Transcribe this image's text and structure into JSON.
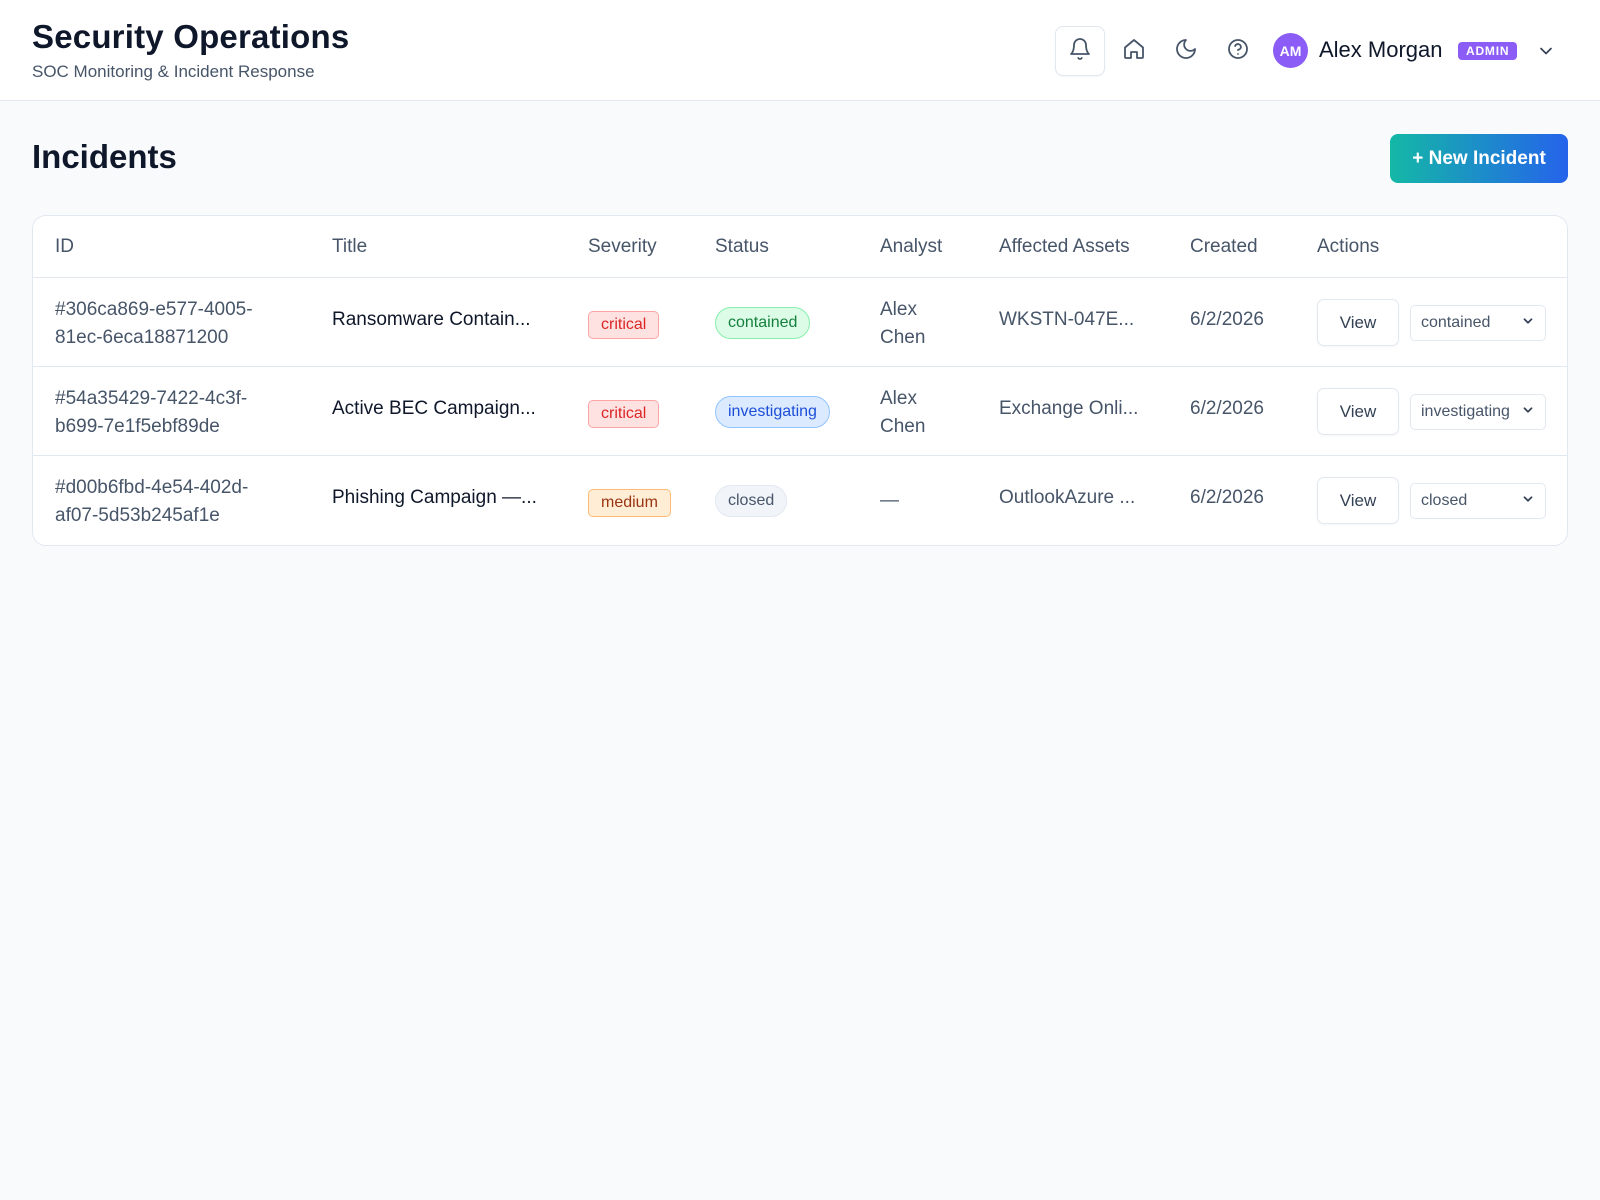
{
  "header": {
    "title": "Security Operations",
    "subtitle": "SOC Monitoring & Incident Response",
    "user": {
      "initials": "AM",
      "name": "Alex Morgan",
      "role": "ADMIN"
    },
    "icons": [
      "bell-icon",
      "home-icon",
      "moon-icon",
      "help-icon",
      "chevron-down-icon"
    ]
  },
  "page": {
    "title": "Incidents",
    "new_button_label": "+ New Incident"
  },
  "table": {
    "columns": [
      "ID",
      "Title",
      "Severity",
      "Status",
      "Analyst",
      "Affected Assets",
      "Created",
      "Actions"
    ],
    "rows": [
      {
        "id_line1": "#306ca869-e577-4005-",
        "id_line2": "81ec-6eca18871200",
        "title": "Ransomware Contain...",
        "severity": "critical",
        "status": "contained",
        "analyst_line1": "Alex",
        "analyst_line2": "Chen",
        "assets": "WKSTN-047E...",
        "created": "6/2/2026",
        "view_label": "View",
        "select_value": "contained"
      },
      {
        "id_line1": "#54a35429-7422-4c3f-",
        "id_line2": "b699-7e1f5ebf89de",
        "title": "Active BEC Campaign...",
        "severity": "critical",
        "status": "investigating",
        "analyst_line1": "Alex",
        "analyst_line2": "Chen",
        "assets": "Exchange Onli...",
        "created": "6/2/2026",
        "view_label": "View",
        "select_value": "investigating"
      },
      {
        "id_line1": "#d00b6fbd-4e54-402d-",
        "id_line2": "af07-5d53b245af1e",
        "title": "Phishing Campaign —...",
        "severity": "medium",
        "status": "closed",
        "analyst_line1": "—",
        "analyst_line2": "",
        "assets": "OutlookAzure ...",
        "created": "6/2/2026",
        "view_label": "View",
        "select_value": "closed"
      }
    ]
  },
  "colors": {
    "critical_bg": "#fee2e2",
    "critical_border": "#fca5a5",
    "critical_text": "#dc2626",
    "medium_bg": "#ffedd5",
    "medium_border": "#fdba74",
    "medium_text": "#9a3412",
    "contained_bg": "#dcfce7",
    "contained_text": "#15803d",
    "investigating_bg": "#dbeafe",
    "investigating_text": "#1d4ed8",
    "closed_bg": "#f1f5f9",
    "closed_text": "#475569",
    "avatar": "#8b5cf6",
    "accent_gradient_start": "#14b8a6",
    "accent_gradient_end": "#2563eb"
  }
}
